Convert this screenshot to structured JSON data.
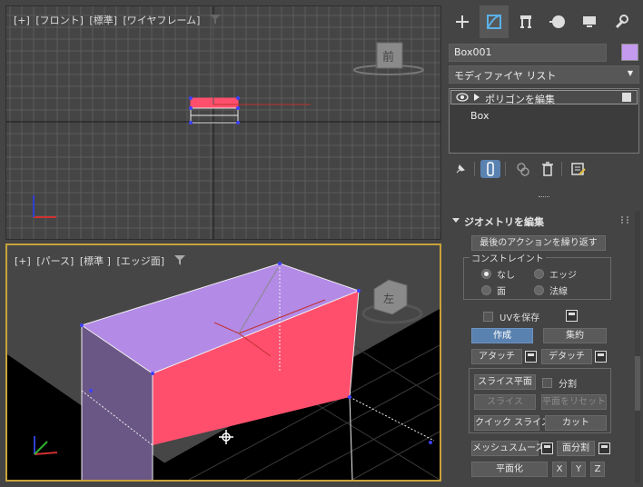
{
  "top_viewport": {
    "labels": [
      "[+]",
      "[フロント]",
      "[標準]",
      "[ワイヤフレーム]"
    ],
    "nav_cube_label": "前"
  },
  "persp_viewport": {
    "labels": [
      "[+]",
      "[パース]",
      "[標準 ]",
      "[エッジ面]"
    ],
    "nav_cube_label": "左"
  },
  "panel": {
    "object_name": "Box001",
    "object_color": "#c49aef",
    "modifier_list": "モディファイヤ リスト",
    "stack": {
      "modifier": "ポリゴンを編集",
      "base": "Box"
    },
    "rollout_title": "ジオメトリを編集",
    "repeat_last": "最後のアクションを繰り返す",
    "constraints": {
      "title": "コンストレイント",
      "none": "なし",
      "edge": "エッジ",
      "face": "面",
      "normal": "法線"
    },
    "preserve_uv": "UVを保存",
    "create": "作成",
    "collapse": "集約",
    "attach": "アタッチ",
    "detach": "デタッチ",
    "slice_plane": "スライス平面",
    "split": "分割",
    "slice": "スライス",
    "reset_plane": "平面をリセット",
    "quickslice": "クイック スライス",
    "cut": "カット",
    "meshsmooth": "メッシュスムーズ",
    "tessellate": "面分割",
    "make_planar": "平面化",
    "x": "X",
    "y": "Y",
    "z": "Z"
  },
  "colors": {
    "accent_blue": "#5a82b0",
    "selected_face": "#ff4f6d",
    "box_top": "#b38ae6",
    "box_side": "#6a5785",
    "viewport_active_border": "#c8a23a"
  }
}
